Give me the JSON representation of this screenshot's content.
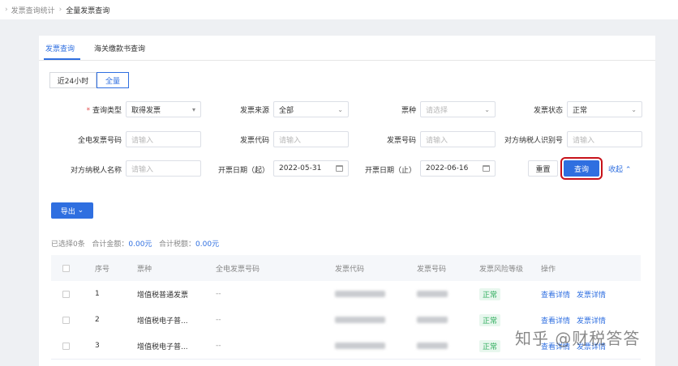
{
  "breadcrumb": {
    "items": [
      "发票查询统计",
      "全量发票查询"
    ]
  },
  "tabs": [
    "发票查询",
    "海关缴款书查询"
  ],
  "time_range": {
    "options": [
      "近24小时",
      "全量"
    ],
    "selected": "全量"
  },
  "form": {
    "query_type": {
      "label": "查询类型",
      "value": "取得发票"
    },
    "invoice_source": {
      "label": "发票来源",
      "value": "全部"
    },
    "ticket_type": {
      "label": "票种",
      "placeholder": "请选择"
    },
    "invoice_status": {
      "label": "发票状态",
      "value": "正常"
    },
    "full_invoice_no": {
      "label": "全电发票号码",
      "placeholder": "请输入"
    },
    "invoice_code": {
      "label": "发票代码",
      "placeholder": "请输入"
    },
    "invoice_no": {
      "label": "发票号码",
      "placeholder": "请输入"
    },
    "counterparty_tax_id": {
      "label": "对方纳税人识别号",
      "placeholder": "请输入"
    },
    "counterparty_name": {
      "label": "对方纳税人名称",
      "placeholder": "请输入"
    },
    "date_start": {
      "label": "开票日期（起）",
      "value": "2022-05-31"
    },
    "date_end": {
      "label": "开票日期（止）",
      "value": "2022-06-16"
    },
    "reset_label": "重置",
    "query_label": "查询",
    "collapse_label": "收起"
  },
  "export_label": "导出",
  "summary": {
    "selected_prefix": "已选择",
    "selected_count": "0",
    "selected_suffix": "条",
    "total_amount_label": "合计金额：",
    "total_amount": "0.00元",
    "total_tax_label": "合计税额：",
    "total_tax": "0.00元"
  },
  "table": {
    "columns": [
      "序号",
      "票种",
      "全电发票号码",
      "发票代码",
      "发票号码",
      "发票风险等级",
      "操作"
    ],
    "rows": [
      {
        "index": "1",
        "type": "增值税普通发票",
        "full_no": "--",
        "risk": "正常",
        "actions": [
          "查看详情",
          "发票详情"
        ]
      },
      {
        "index": "2",
        "type": "增值税电子普...",
        "full_no": "--",
        "risk": "正常",
        "actions": [
          "查看详情",
          "发票详情"
        ]
      },
      {
        "index": "3",
        "type": "增值税电子普...",
        "full_no": "--",
        "risk": "正常",
        "actions": [
          "查看详情",
          "发票详情"
        ]
      }
    ]
  },
  "watermark": "知乎 @财税答答",
  "colors": {
    "accent": "#2f6fe0",
    "highlight_border": "#c7121a",
    "risk_ok": "#2eac5c"
  }
}
